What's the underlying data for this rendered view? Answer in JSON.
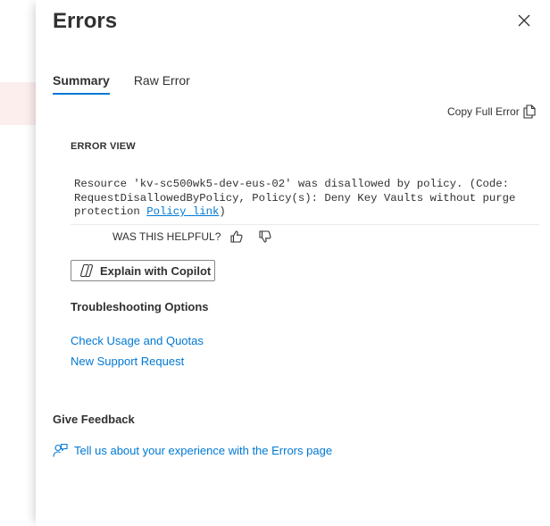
{
  "blade": {
    "title": "Errors",
    "close_icon": "close-icon"
  },
  "tabs": [
    {
      "label": "Summary",
      "active": true
    },
    {
      "label": "Raw Error",
      "active": false
    }
  ],
  "copy_full_error": {
    "label": "Copy Full Error",
    "icon": "copy-icon"
  },
  "error_view": {
    "label": "ERROR VIEW",
    "message_line1": "Resource 'kv-sc500wk5-dev-eus-02' was disallowed by policy. (Code:",
    "message_line2": "RequestDisallowedByPolicy, Policy(s): Deny Key Vaults without purge",
    "message_line3_prefix": "protection ",
    "policy_link": "Policy link",
    "message_line3_suffix": ")"
  },
  "helpful": {
    "label": "WAS THIS HELPFUL?",
    "thumbs_up_icon": "thumbs-up-icon",
    "thumbs_down_icon": "thumbs-down-icon"
  },
  "copilot": {
    "label": "Explain with Copilot",
    "icon": "copilot-icon"
  },
  "troubleshooting": {
    "heading": "Troubleshooting Options",
    "links": [
      "Check Usage and Quotas",
      "New Support Request"
    ]
  },
  "feedback": {
    "heading": "Give Feedback",
    "link": "Tell us about your experience with the Errors page",
    "icon": "feedback-person-icon"
  },
  "colors": {
    "accent": "#0078d4",
    "text": "#323130",
    "highlight_bg": "#fdeeee"
  }
}
